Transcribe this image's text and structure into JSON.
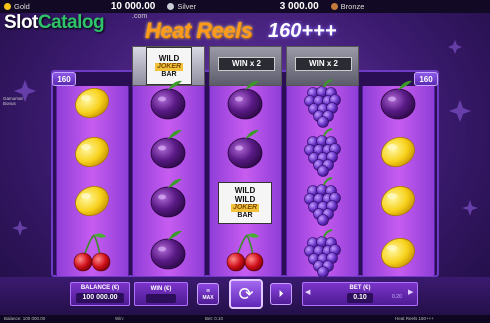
{
  "jackpots": [
    {
      "name": "Gold",
      "value": "10 000.00",
      "color": "#f5c518"
    },
    {
      "name": "Silver",
      "value": "3 000.00",
      "color": "#c9ccd6"
    },
    {
      "name": "Bronze",
      "value": "",
      "color": "#c47a3a"
    }
  ],
  "watermark": {
    "prefix": "Slot",
    "accent": "Catalog",
    "suffix": ".com"
  },
  "game": {
    "title": "Heat Reels",
    "subtitle": "160+++"
  },
  "provider": {
    "line1": "Gamomat",
    "line2": "Bonus"
  },
  "win_badges": [
    "160",
    "160"
  ],
  "reel_heads": [
    {
      "label": "",
      "wild_title": "WILD",
      "wild_joker": "JOKER",
      "wild_bar": "BAR"
    },
    {
      "label": "WIN x 2"
    },
    {
      "label": "WIN x 2"
    }
  ],
  "reels": [
    [
      "lemon",
      "lemon",
      "lemon",
      "cherry"
    ],
    [
      "plum",
      "plum",
      "plum",
      "plum"
    ],
    [
      "plum",
      "plum",
      "wild-joker-bar",
      "cherry"
    ],
    [
      "grapes",
      "grapes",
      "grapes",
      "grapes"
    ],
    [
      "plum",
      "lemon",
      "lemon",
      "lemon"
    ]
  ],
  "wild_stack": {
    "line1": "WILD",
    "line2": "WILD",
    "joker": "JOKER",
    "bar": "BAR"
  },
  "controls": {
    "balance_label": "BALANCE (€)",
    "balance_value": "100 000.00",
    "win_label": "WIN (€)",
    "win_value": "",
    "max_label": "MAX",
    "bet_label": "BET (€)",
    "bet_value": "0.10",
    "bet_alt": "0.20"
  },
  "status": {
    "balance": "Balance: 100 000.00",
    "win": "Win:",
    "bet": "Bet: 0.10",
    "game": "Heat Reels 160+++"
  },
  "colors": {
    "accent_purple": "#8c4ee0",
    "title_orange": "#ff9a1a",
    "watermark_green": "#2ec46a"
  }
}
